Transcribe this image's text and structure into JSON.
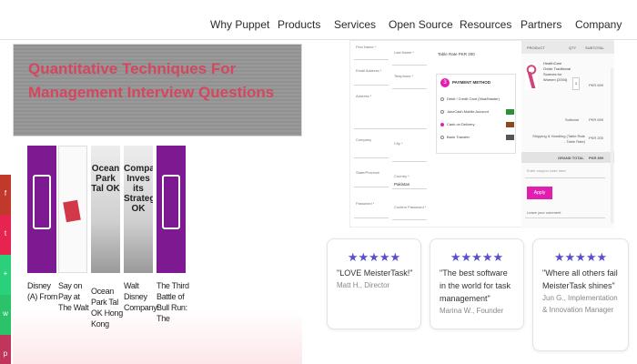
{
  "nav": {
    "items": [
      "Why Puppet",
      "Products",
      "Services",
      "Open Source",
      "Resources",
      "Partners",
      "Company"
    ]
  },
  "banner": {
    "title": "Quantitative Techniques For Management Interview Questions"
  },
  "books": [
    {
      "label": "Disney (A) From"
    },
    {
      "label": "Say on Pay at The Walt"
    },
    {
      "label": "Ocean Park Tal OK Hong Kong",
      "spine": "Ocean Park Tal OK"
    },
    {
      "label": "Walt Disney Company:",
      "spine": "Company Inves its Strategy OK"
    },
    {
      "label": "The Third Battle of Bull Run: The"
    }
  ],
  "checkout": {
    "form_labels": {
      "first_name": "First Name *",
      "last_name": "Last Name *",
      "email": "Email Address *",
      "telephone": "Telephone *",
      "address": "Address *",
      "company": "Company",
      "city": "City *",
      "state": "State/Province",
      "country": "Country *",
      "country_value": "Pakistan",
      "password": "Password *",
      "confirm_password": "Confirm Password *",
      "table_rate": "Table Rate PKR 200"
    },
    "payment": {
      "step": "3",
      "title": "PAYMENT METHOD",
      "options": [
        "Debit / Credit Card (Visa/Master)",
        "JazzCash Mobile Account",
        "Cash on Delivery",
        "Bank Transfer"
      ]
    },
    "summary": {
      "col_product": "PRODUCT",
      "col_qty": "QTY",
      "col_subtotal": "SUBTOTAL",
      "product_name": "HealthCare Oxide Traditional Scarves for Women (2004)",
      "qty": "1",
      "line_amount": "PKR 699",
      "subtotal_label": "Subtotal",
      "subtotal_value": "PKR 699",
      "shipping_label": "Shipping & Handling (Table Rate - Table Rate)",
      "shipping_value": "PKR 200",
      "grand_label": "GRAND TOTAL",
      "grand_value": "PKR 899",
      "coupon_placeholder": "Enter coupon code here",
      "apply_label": "Apply",
      "comment_label": "Leave your comment"
    }
  },
  "testimonials": [
    {
      "stars": "★★★★★",
      "quote": "\"LOVE MeisterTask!\"",
      "author": "Matt H., Director"
    },
    {
      "stars": "★★★★★",
      "quote": "\"The best software in the world for task management\"",
      "author": "Marina W., Founder"
    },
    {
      "stars": "★★★★★",
      "quote": "\"Where all others fail MeisterTask shines\"",
      "author": "Jun G., Implementation & Innovation Manager"
    }
  ],
  "colors": {
    "banner_title": "#d4475e",
    "book_purple": "#7d1a91",
    "star": "#5a4fcf",
    "accent_pink": "#e01fb0",
    "social": [
      "#c0392b",
      "#e6244f",
      "#2bd07a",
      "#2bc26a",
      "#c0355b"
    ]
  },
  "social_icons": [
    "facebook-icon",
    "twitter-icon",
    "share-icon",
    "whatsapp-icon",
    "pinterest-icon"
  ]
}
